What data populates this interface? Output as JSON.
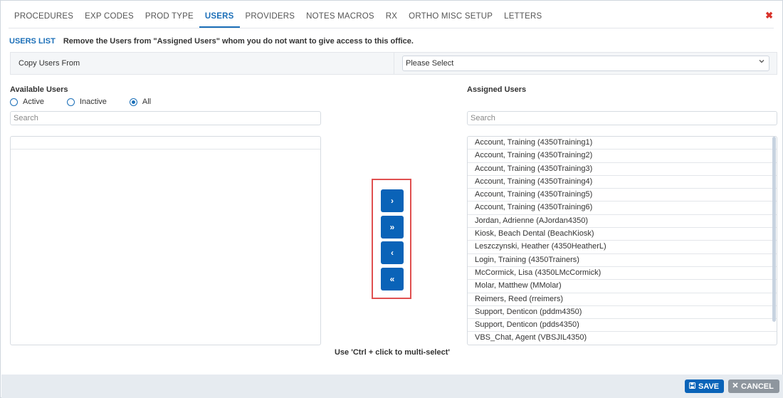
{
  "tabs": [
    {
      "label": "PROCEDURES",
      "active": false
    },
    {
      "label": "EXP CODES",
      "active": false
    },
    {
      "label": "PROD TYPE",
      "active": false
    },
    {
      "label": "USERS",
      "active": true
    },
    {
      "label": "PROVIDERS",
      "active": false
    },
    {
      "label": "NOTES MACROS",
      "active": false
    },
    {
      "label": "RX",
      "active": false
    },
    {
      "label": "ORTHO MISC SETUP",
      "active": false
    },
    {
      "label": "LETTERS",
      "active": false
    }
  ],
  "close_glyph": "✖",
  "users_list": {
    "title": "USERS LIST",
    "description": "Remove the Users from \"Assigned Users\" whom you do not want to give access to this office."
  },
  "copy_users": {
    "label": "Copy Users From",
    "selected": "Please Select"
  },
  "available": {
    "title": "Available Users",
    "filters": [
      {
        "label": "Active",
        "checked": false
      },
      {
        "label": "Inactive",
        "checked": false
      },
      {
        "label": "All",
        "checked": true
      }
    ],
    "search_placeholder": "Search",
    "items": []
  },
  "move_buttons": {
    "add_one": "›",
    "add_all": "»",
    "remove_one": "‹",
    "remove_all": "«"
  },
  "assigned": {
    "title": "Assigned Users",
    "search_placeholder": "Search",
    "items": [
      "Account, Training (4350Training1)",
      "Account, Training (4350Training2)",
      "Account, Training (4350Training3)",
      "Account, Training (4350Training4)",
      "Account, Training (4350Training5)",
      "Account, Training (4350Training6)",
      "Jordan, Adrienne (AJordan4350)",
      "Kiosk, Beach Dental (BeachKiosk)",
      "Leszczynski, Heather (4350HeatherL)",
      "Login, Training (4350Trainers)",
      "McCormick, Lisa (4350LMcCormick)",
      "Molar, Matthew (MMolar)",
      "Reimers, Reed (rreimers)",
      "Support, Denticon (pddm4350)",
      "Support, Denticon (pdds4350)",
      "VBS_Chat, Agent (VBSJIL4350)"
    ]
  },
  "hint": "Use 'Ctrl + click to multi-select'",
  "footer": {
    "save_label": "SAVE",
    "cancel_label": "CANCEL"
  },
  "colors": {
    "accent": "#0a63b8",
    "close": "#d9332b",
    "highlight_box": "#e05050",
    "cancel": "#8e969e"
  }
}
